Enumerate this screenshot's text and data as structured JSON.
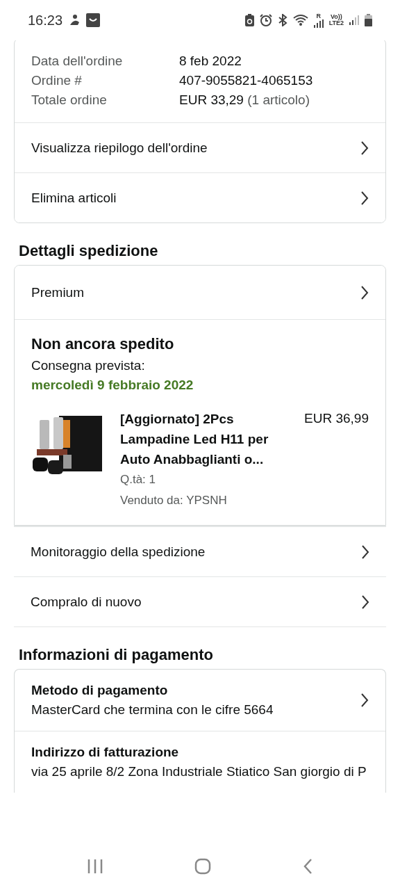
{
  "status_bar": {
    "time": "16:23",
    "roaming": "R",
    "volte": "Vo))",
    "network": "LTE2"
  },
  "order_summary": {
    "fields": [
      {
        "label": "Data dell'ordine",
        "value": "8 feb 2022"
      },
      {
        "label": "Ordine #",
        "value": "407-9055821-4065153"
      },
      {
        "label": "Totale ordine",
        "value": "EUR 33,29",
        "note": "(1 articolo)"
      }
    ],
    "links": [
      "Visualizza riepilogo dell'ordine",
      "Elimina articoli"
    ]
  },
  "shipping": {
    "heading": "Dettagli spedizione",
    "method": "Premium",
    "status": "Non ancora spedito",
    "delivery_label": "Consegna prevista:",
    "delivery_date": "mercoledì 9 febbraio 2022",
    "item": {
      "title": "[Aggiornato] 2Pcs Lampadine Led H11 per Auto Anabbaglianti o...",
      "price": "EUR 36,99",
      "quantity": "Q.tà: 1",
      "seller": "Venduto da: YPSNH"
    },
    "actions": [
      "Monitoraggio della spedizione",
      "Compralo di nuovo"
    ]
  },
  "payment": {
    "heading": "Informazioni di pagamento",
    "sections": [
      {
        "kind": "link",
        "title": "Metodo di pagamento",
        "text": "MasterCard che termina con le cifre 5664"
      },
      {
        "kind": "plain",
        "title": "Indirizzo di fatturazione",
        "text": "via 25 aprile 8/2 Zona Industriale Stiatico San giorgio di P"
      }
    ]
  }
}
